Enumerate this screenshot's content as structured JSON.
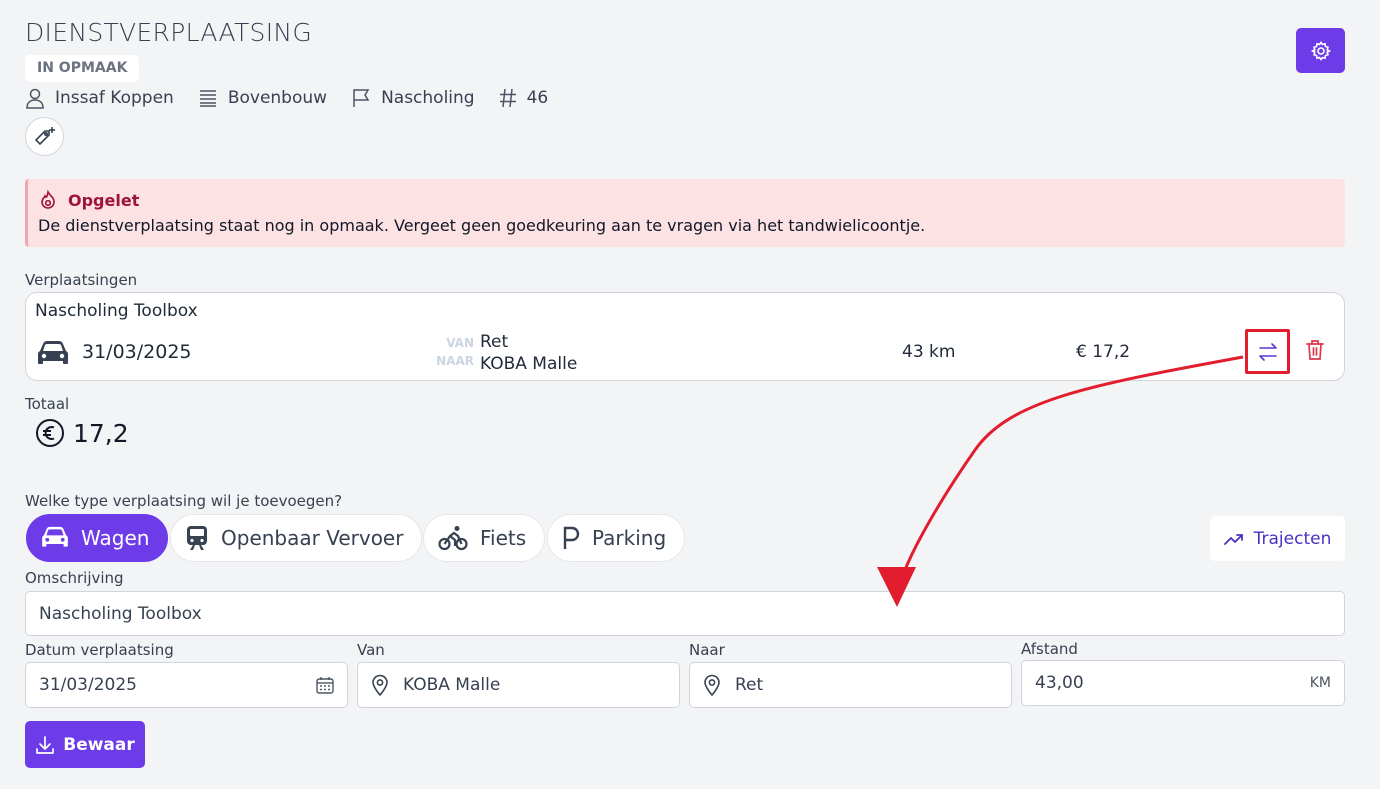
{
  "header": {
    "title": "DIENSTVERPLAATSING",
    "status_badge": "IN OPMAAK",
    "meta": {
      "person": "Inssaf Koppen",
      "department": "Bovenbouw",
      "category": "Nascholing",
      "number": "46"
    }
  },
  "alert": {
    "title": "Opgelet",
    "text": "De dienstverplaatsing staat nog in opmaak. Vergeet geen goedkeuring aan te vragen via het tandwielicoontje."
  },
  "trips": {
    "label": "Verplaatsingen",
    "items": [
      {
        "title": "Nascholing Toolbox",
        "date": "31/03/2025",
        "from_tag": "VAN",
        "from": "Ret",
        "to_tag": "NAAR",
        "to": "KOBA Malle",
        "distance": "43 km",
        "amount": "€ 17,2"
      }
    ]
  },
  "total": {
    "label": "Totaal",
    "value": "17,2"
  },
  "type_selector": {
    "question": "Welke type verplaatsing wil je toevoegen?",
    "options": [
      "Wagen",
      "Openbaar Vervoer",
      "Fiets",
      "Parking"
    ],
    "selected": "Wagen",
    "trajecten_label": "Trajecten"
  },
  "form": {
    "description_label": "Omschrijving",
    "description_value": "Nascholing Toolbox",
    "date_label": "Datum verplaatsing",
    "date_value": "31/03/2025",
    "from_label": "Van",
    "from_value": "KOBA Malle",
    "to_label": "Naar",
    "to_value": "Ret",
    "distance_label": "Afstand",
    "distance_value": "43,00",
    "distance_unit": "KM",
    "save_label": "Bewaar"
  },
  "colors": {
    "primary": "#6d3ce8",
    "alert_bg": "#fde2e4",
    "alert_title": "#9f1239",
    "annotation_red": "#e11d2e",
    "delete_red": "#e0354a"
  }
}
